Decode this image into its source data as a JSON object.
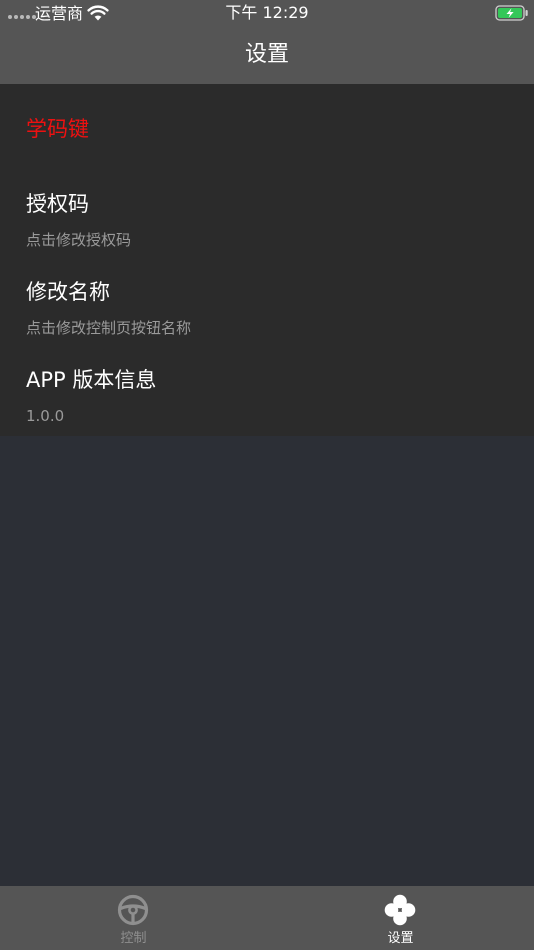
{
  "status_bar": {
    "carrier": "运营商",
    "time": "下午 12:29",
    "icons": [
      "signal-icon",
      "wifi-icon",
      "battery-charging-icon"
    ]
  },
  "nav": {
    "title": "设置"
  },
  "settings": {
    "learn_key_label": "学码键",
    "items": [
      {
        "title": "授权码",
        "subtitle": "点击修改授权码"
      },
      {
        "title": "修改名称",
        "subtitle": "点击修改控制页按钮名称"
      },
      {
        "title": "APP 版本信息",
        "subtitle": "1.0.0"
      }
    ]
  },
  "tabbar": {
    "tabs": [
      {
        "label": "控制",
        "icon": "steering-wheel-icon",
        "selected": false
      },
      {
        "label": "设置",
        "icon": "four-circles-icon",
        "selected": true
      }
    ]
  },
  "colors": {
    "nav_background": "#555555",
    "page_background": "#2c2f36",
    "card_background": "#2b2b2b",
    "accent_red": "#ee1111",
    "subtitle_gray": "#9a9a9a",
    "battery_green": "#34c759"
  }
}
